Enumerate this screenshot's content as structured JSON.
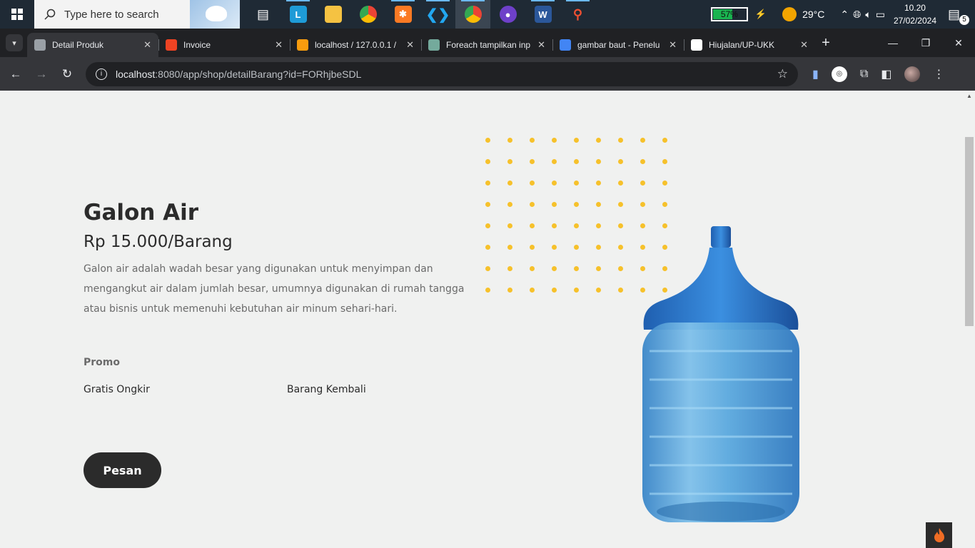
{
  "taskbar": {
    "search_placeholder": "Type here to search",
    "battery": "57%",
    "temperature": "29°C",
    "time": "10.20",
    "date": "27/02/2024",
    "notifications": "5"
  },
  "browser": {
    "tabs": [
      {
        "title": "Detail Produk",
        "favicon": "globe-icon",
        "color": "#9aa0a6"
      },
      {
        "title": "Invoice",
        "favicon": "codeigniter-icon",
        "color": "#ee4323"
      },
      {
        "title": "localhost / 127.0.0.1 / ",
        "favicon": "phpmyadmin-icon",
        "color": "#f89c0e"
      },
      {
        "title": "Foreach tampilkan inp",
        "favicon": "chatgpt-icon",
        "color": "#74aa9c"
      },
      {
        "title": "gambar baut - Penelu",
        "favicon": "google-icon",
        "color": "#4285f4"
      },
      {
        "title": "Hiujalan/UP-UKK",
        "favicon": "github-icon",
        "color": "#ffffff"
      }
    ],
    "url_host": "localhost",
    "url_rest": ":8080/app/shop/detailBarang?id=FORhjbeSDL"
  },
  "product": {
    "name": "Galon Air",
    "price": "Rp 15.000/Barang",
    "description": "Galon air adalah wadah besar yang digunakan untuk menyimpan dan mengangkut air dalam jumlah besar, umumnya digunakan di rumah tangga atau bisnis untuk memenuhi kebutuhan air minum sehari-hari.",
    "promo_label": "Promo",
    "promos": [
      "Gratis Ongkir",
      "Barang Kembali"
    ],
    "order_label": "Pesan",
    "accent_color": "#f6c12b"
  }
}
